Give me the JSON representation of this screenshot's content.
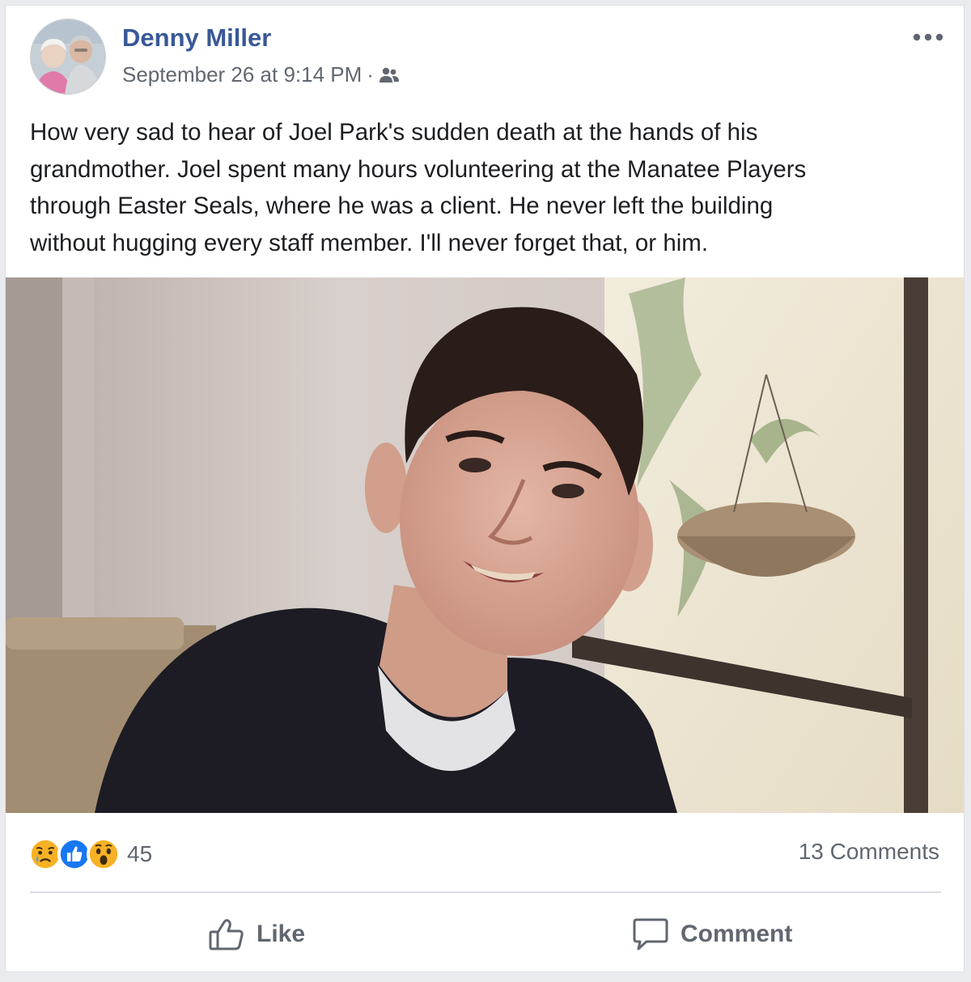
{
  "post": {
    "author": "Denny Miller",
    "timestamp": "September 26 at 9:14 PM",
    "separator": "·",
    "audience_icon": "friends-icon",
    "more_icon": "more-options-icon",
    "text_lines": [
      "How very sad to hear of Joel Park's sudden death at the hands of his",
      "grandmother. Joel spent many hours volunteering at the Manatee Players",
      "through Easter Seals, where he was a client. He never left the building",
      "without hugging every staff member. I'll never forget that, or him."
    ]
  },
  "reactions": {
    "icons": [
      "sad-reaction-icon",
      "like-reaction-icon",
      "wow-reaction-icon"
    ],
    "count": "45"
  },
  "comments_count": "13 Comments",
  "actions": {
    "like_label": "Like",
    "comment_label": "Comment"
  },
  "colors": {
    "author_link": "#385898",
    "meta_text": "#616770",
    "like_blue": "#1877f2",
    "reaction_yellow": "#f7b125"
  }
}
